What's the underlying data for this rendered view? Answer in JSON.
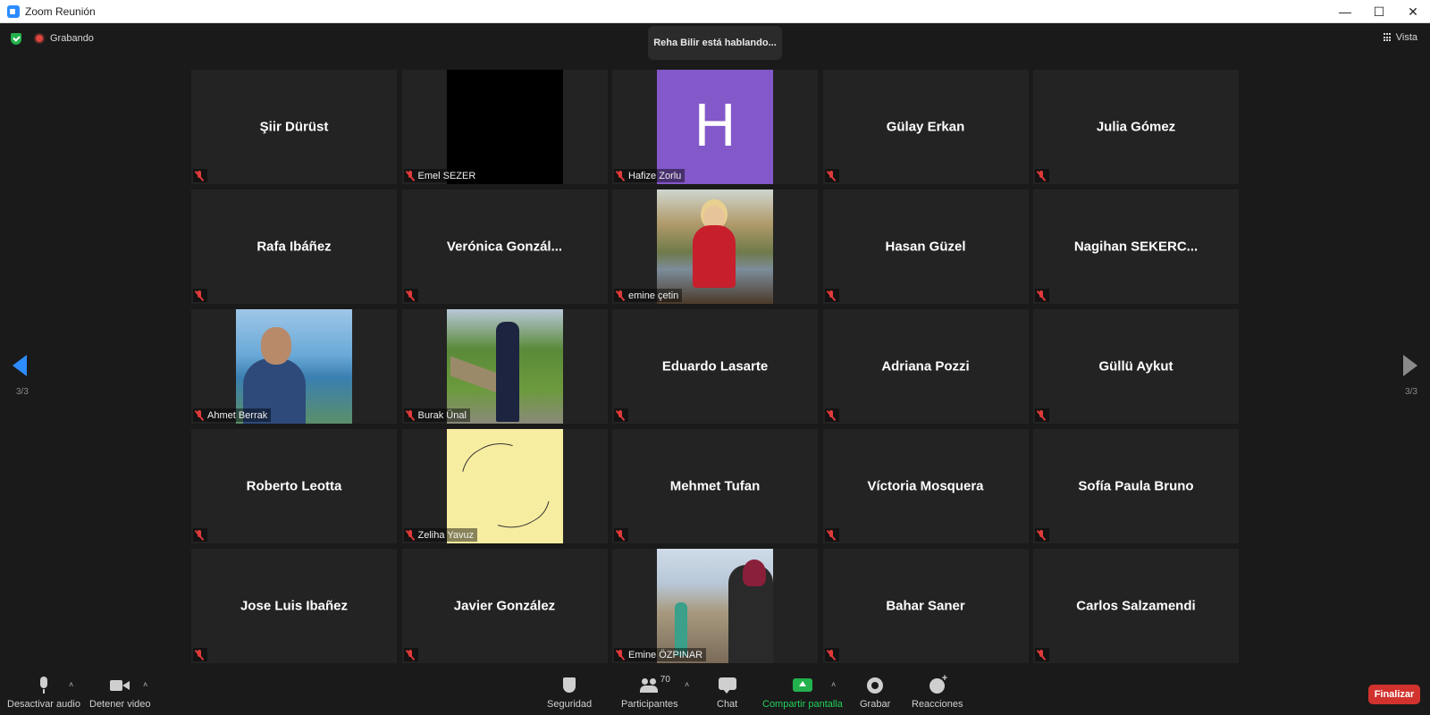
{
  "window": {
    "title": "Zoom Reunión",
    "minimize_glyph": "—",
    "maximize_glyph": "☐",
    "close_glyph": "✕"
  },
  "meeting": {
    "recording_label": "Grabando",
    "active_speaker": "Reha Bilir está hablando...",
    "view_label": "Vista",
    "page_left": "3/3",
    "page_right": "3/3"
  },
  "participants": [
    {
      "name": "Şiir Dürüst",
      "show_label": false
    },
    {
      "name": "Emel SEZER",
      "show_label": true,
      "photo": "black"
    },
    {
      "name": "Hafize Zorlu",
      "show_label": true,
      "photo": "purple",
      "initial": "H"
    },
    {
      "name": "Gülay Erkan",
      "show_label": false
    },
    {
      "name": "Julia Gómez",
      "show_label": false
    },
    {
      "name": "Rafa Ibáñez",
      "show_label": false
    },
    {
      "name": "Verónica  Gonzál...",
      "show_label": false
    },
    {
      "name": "emine çetin",
      "show_label": true,
      "photo": "forest"
    },
    {
      "name": "Hasan Güzel",
      "show_label": false
    },
    {
      "name": "Nagihan  SEKERC...",
      "show_label": false
    },
    {
      "name": "Ahmet Berrak",
      "show_label": true,
      "photo": "sea"
    },
    {
      "name": "Burak Ünal",
      "show_label": true,
      "photo": "park"
    },
    {
      "name": "Eduardo Lasarte",
      "show_label": false
    },
    {
      "name": "Adriana Pozzi",
      "show_label": false
    },
    {
      "name": "Güllü Aykut",
      "show_label": false
    },
    {
      "name": "Roberto Leotta",
      "show_label": false
    },
    {
      "name": "Zeliha Yavuz",
      "show_label": true,
      "photo": "paper"
    },
    {
      "name": "Mehmet Tufan",
      "show_label": false
    },
    {
      "name": "Víctoria Mosquera",
      "show_label": false
    },
    {
      "name": "Sofía Paula Bruno",
      "show_label": false
    },
    {
      "name": "Jose Luis Ibañez",
      "show_label": false
    },
    {
      "name": "Javier González",
      "show_label": false
    },
    {
      "name": "Emine ÖZPINAR",
      "show_label": true,
      "photo": "city"
    },
    {
      "name": "Bahar Saner",
      "show_label": false
    },
    {
      "name": "Carlos Salzamendi",
      "show_label": false
    }
  ],
  "toolbar": {
    "mute_label": "Desactivar audio",
    "video_label": "Detener video",
    "security_label": "Seguridad",
    "participants_label": "Participantes",
    "participants_count": "70",
    "chat_label": "Chat",
    "share_label": "Compartir pantalla",
    "record_label": "Grabar",
    "reactions_label": "Reacciones",
    "end_label": "Finalizar",
    "caret": "˄"
  },
  "colors": {
    "accent": "#2d8cff",
    "share_green": "#23b14d",
    "end_red": "#d2322d",
    "muted_red": "#e03a3a",
    "avatar_purple": "#8358c9"
  }
}
